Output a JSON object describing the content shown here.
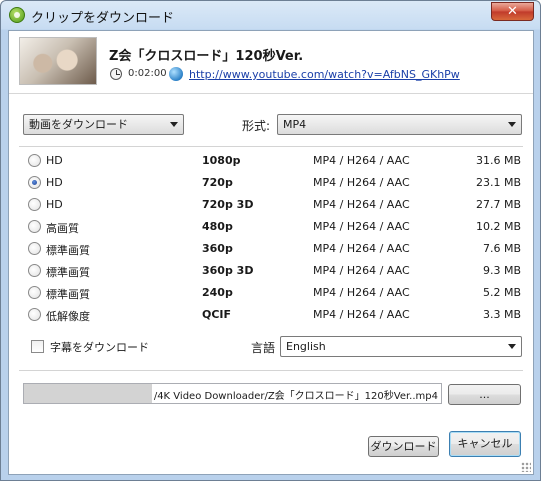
{
  "window": {
    "title": "クリップをダウンロード",
    "close_glyph": "✕"
  },
  "video": {
    "title": "Z会「クロスロード」120秒Ver.",
    "duration": "0:02:00",
    "url": "http://www.youtube.com/watch?v=AfbNS_GKhPw"
  },
  "controls": {
    "mode_select": "動画をダウンロード",
    "format_label": "形式:",
    "format_select": "MP4"
  },
  "qualities": [
    {
      "name": "HD",
      "resolution": "1080p",
      "format": "MP4 / H264 / AAC",
      "size": "31.6 MB",
      "selected": false
    },
    {
      "name": "HD",
      "resolution": "720p",
      "format": "MP4 / H264 / AAC",
      "size": "23.1 MB",
      "selected": true
    },
    {
      "name": "HD",
      "resolution": "720p 3D",
      "format": "MP4 / H264 / AAC",
      "size": "27.7 MB",
      "selected": false
    },
    {
      "name": "高画質",
      "resolution": "480p",
      "format": "MP4 / H264 / AAC",
      "size": "10.2 MB",
      "selected": false
    },
    {
      "name": "標準画質",
      "resolution": "360p",
      "format": "MP4 / H264 / AAC",
      "size": "7.6 MB",
      "selected": false
    },
    {
      "name": "標準画質",
      "resolution": "360p 3D",
      "format": "MP4 / H264 / AAC",
      "size": "9.3 MB",
      "selected": false
    },
    {
      "name": "標準画質",
      "resolution": "240p",
      "format": "MP4 / H264 / AAC",
      "size": "5.2 MB",
      "selected": false
    },
    {
      "name": "低解像度",
      "resolution": "QCIF",
      "format": "MP4 / H264 / AAC",
      "size": "3.3 MB",
      "selected": false
    }
  ],
  "subtitles": {
    "checkbox_label": "字幕をダウンロード",
    "checked": false,
    "language_label": "言語",
    "language_select": "English"
  },
  "output": {
    "path": "/4K Video Downloader/Z会「クロスロード」120秒Ver..mp4",
    "browse_label": "..."
  },
  "buttons": {
    "download": "ダウンロード",
    "cancel": "キャンセル"
  },
  "colors": {
    "titlebar": "#c7dcf2",
    "close": "#c0392b",
    "link": "#1a3fa8",
    "radio_dot": "#1b3f93"
  },
  "icons": [
    "app-icon",
    "close-icon",
    "clock-icon",
    "globe-icon",
    "chevron-down-icon"
  ]
}
